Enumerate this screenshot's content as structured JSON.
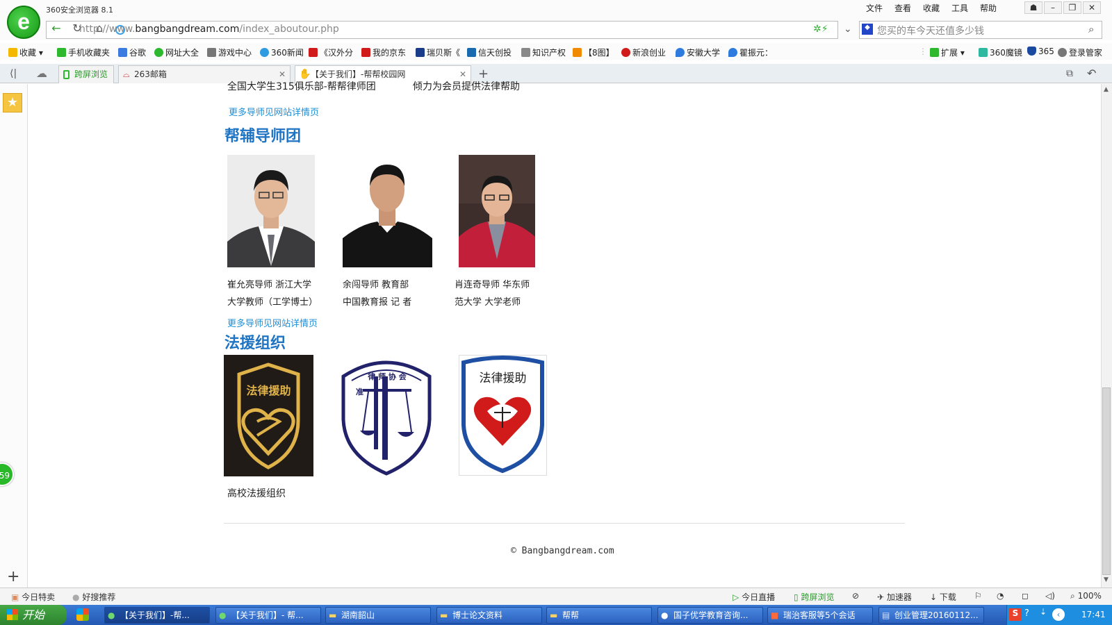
{
  "window": {
    "app_title": "360安全浏览器 8.1",
    "menu": [
      "文件",
      "查看",
      "收藏",
      "工具",
      "帮助"
    ]
  },
  "address_bar": {
    "url_prefix": "http://www.",
    "url_domain": "bangbangdream.com",
    "url_path": "/index_aboutour.php",
    "search_placeholder": "您买的车今天还值多少钱"
  },
  "bookmarks": [
    {
      "label": "收藏",
      "color": "#f5b800"
    },
    {
      "label": "手机收藏夹",
      "color": "#2eb82e"
    },
    {
      "label": "谷歌",
      "color": "#3b7be0"
    },
    {
      "label": "网址大全",
      "color": "#2eb82e"
    },
    {
      "label": "游戏中心",
      "color": "#777777"
    },
    {
      "label": "360新闻",
      "color": "#2e9be0"
    },
    {
      "label": "《汉外分",
      "color": "#d11a1a"
    },
    {
      "label": "我的京东",
      "color": "#d11a1a"
    },
    {
      "label": "瑞贝斯《",
      "color": "#1a3a8a"
    },
    {
      "label": "信天创投",
      "color": "#1a6ab0"
    },
    {
      "label": "知识产权",
      "color": "#888888"
    },
    {
      "label": "【8图】",
      "color": "#f08a00"
    },
    {
      "label": "新浪创业",
      "color": "#d11a1a"
    },
    {
      "label": "安徽大学",
      "color": "#2e7be0"
    },
    {
      "label": "瞿振元：",
      "color": "#2e7be0"
    },
    {
      "label": "扩展",
      "color": "#2eb82e"
    },
    {
      "label": "360魔镜",
      "color": "#2eb8a0"
    },
    {
      "label": "365",
      "color": "#1a4aa0"
    },
    {
      "label": "登录管家",
      "color": "#777777"
    }
  ],
  "tabs": [
    {
      "label": "跨屏浏览",
      "active": false
    },
    {
      "label": "263邮箱",
      "active": false
    },
    {
      "label": "【关于我们】-帮帮校园网",
      "active": true
    }
  ],
  "content": {
    "cut_left": "全国大学生315俱乐部-帮帮律师团",
    "cut_right": "倾力为会员提供法律帮助",
    "more_link_1": "更多导师见网站详情页",
    "mentor_title": "帮辅导师团",
    "mentors": [
      {
        "line1": "崔允亮导师  浙江大学",
        "line2": "大学教师（工学博士）"
      },
      {
        "line1": "余闯导师    教育部",
        "line2": "中国教育报  记 者"
      },
      {
        "line1": "肖连奇导师    华东师",
        "line2": "范大学      大学老师"
      }
    ],
    "more_link_2": "更多导师见网站详情页",
    "legal_title": "法援组织",
    "logo1_text": "法律援助",
    "logo2_text": "律 师 协 会",
    "logo2_side": "准",
    "logo3_text": "法律援助",
    "legal_caption": "高校法援组织",
    "copyright": "© Bangbangdream.com"
  },
  "sidebar": {
    "badge": "59"
  },
  "statusbar": {
    "left": [
      "今日特卖",
      "好搜推荐"
    ],
    "right": [
      "今日直播",
      "跨屏浏览",
      "加速器",
      "下载",
      "100%"
    ]
  },
  "taskbar": {
    "start": "开始",
    "tasks": [
      "【关于我们】-帮...",
      "【关于我们】- 帮...",
      "湖南韶山",
      "博士论文资料",
      "帮帮",
      "国子优学教育咨询...",
      "瑞治客服等5个会话",
      "创业管理20160112..."
    ],
    "clock": "17:41"
  }
}
